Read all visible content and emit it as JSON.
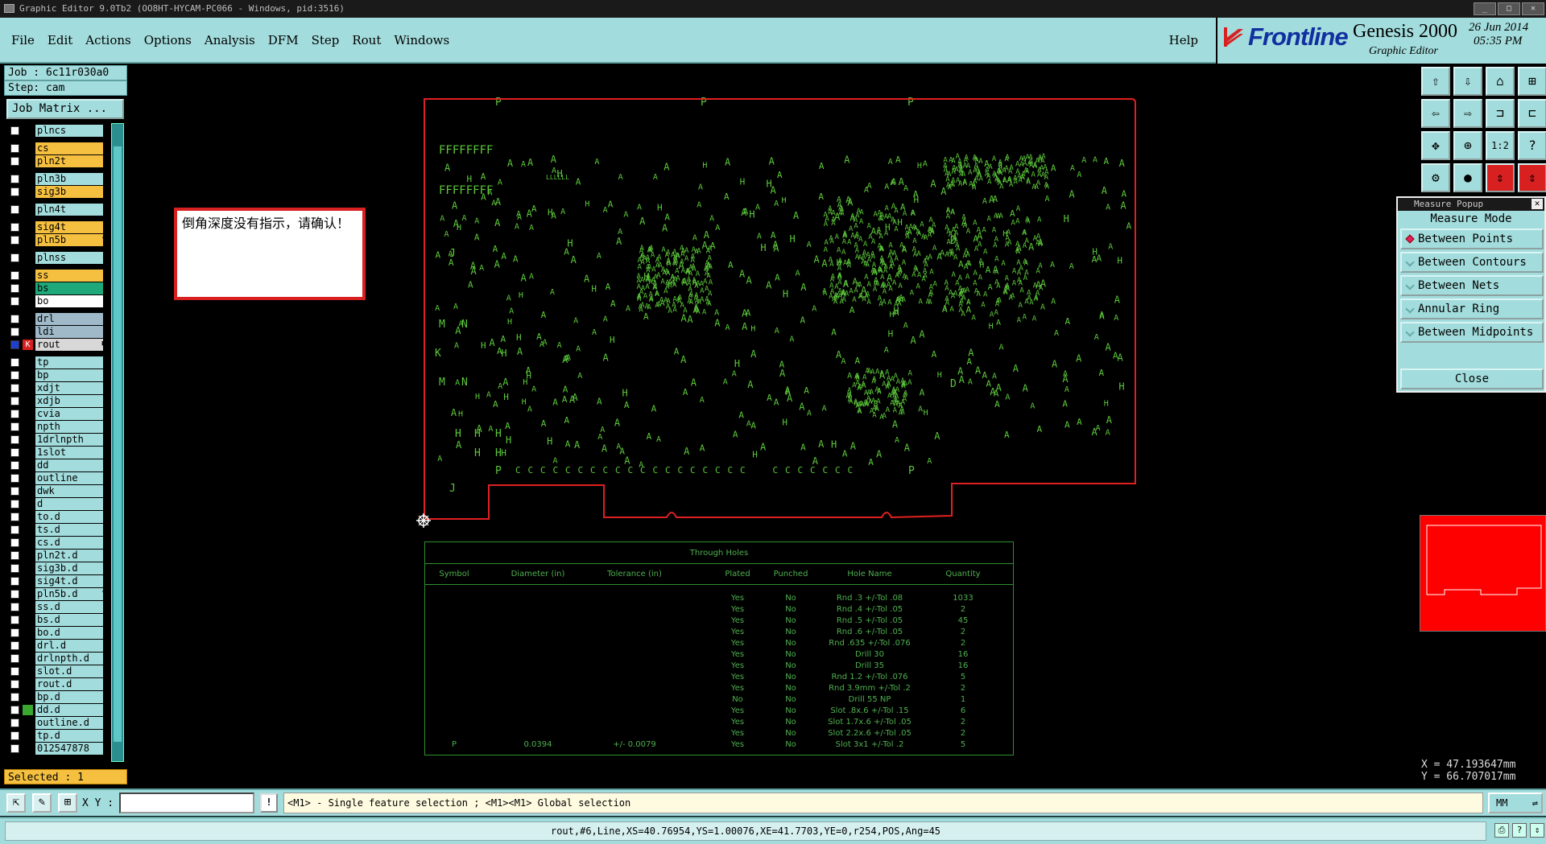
{
  "window": {
    "title": "Graphic Editor 9.0Tb2 (OO8HT-HYCAM-PC066 - Windows, pid:3516)"
  },
  "menu": {
    "items": [
      "File",
      "Edit",
      "Actions",
      "Options",
      "Analysis",
      "DFM",
      "Step",
      "Rout",
      "Windows"
    ],
    "help": "Help"
  },
  "brand": {
    "logo": "Frontline",
    "product": "Genesis 2000",
    "subtitle": "Graphic Editor",
    "date": "26 Jun 2014",
    "time": "05:35 PM"
  },
  "job": {
    "job_label": "Job : 6c11r030a0",
    "step_label": "Step: cam",
    "matrix_button": "Job Matrix ..."
  },
  "layers": [
    {
      "name": "plncs",
      "color": "#a3dcdc"
    },
    {
      "name": "cs",
      "color": "#f5c040"
    },
    {
      "name": "pln2t",
      "color": "#f5c040"
    },
    {
      "name": "pln3b",
      "color": "#a3dcdc"
    },
    {
      "name": "sig3b",
      "color": "#f5c040"
    },
    {
      "name": "pln4t",
      "color": "#a3dcdc"
    },
    {
      "name": "sig4t",
      "color": "#f5c040"
    },
    {
      "name": "pln5b",
      "color": "#f5c040",
      "flag": true
    },
    {
      "name": "plnss",
      "color": "#a3dcdc"
    },
    {
      "name": "ss",
      "color": "#f5c040"
    },
    {
      "name": "bs",
      "color": "#1fa87a"
    },
    {
      "name": "bo",
      "color": "#ffffff"
    },
    {
      "name": "drl",
      "color": "#9fb9c9"
    },
    {
      "name": "ldi",
      "color": "#9fb9c9"
    },
    {
      "name": "rout",
      "color": "#d8d8d8",
      "active": true
    },
    {
      "name": "tp",
      "color": "#a3dcdc"
    },
    {
      "name": "bp",
      "color": "#a3dcdc"
    },
    {
      "name": "xdjt",
      "color": "#a3dcdc"
    },
    {
      "name": "xdjb",
      "color": "#a3dcdc"
    },
    {
      "name": "cvia",
      "color": "#a3dcdc"
    },
    {
      "name": "npth",
      "color": "#a3dcdc"
    },
    {
      "name": "1drlnpth",
      "color": "#a3dcdc"
    },
    {
      "name": "1slot",
      "color": "#a3dcdc"
    },
    {
      "name": "dd",
      "color": "#a3dcdc"
    },
    {
      "name": "outline",
      "color": "#a3dcdc"
    },
    {
      "name": "dwk",
      "color": "#a3dcdc"
    },
    {
      "name": "d",
      "color": "#a3dcdc"
    },
    {
      "name": "to.d",
      "color": "#a3dcdc"
    },
    {
      "name": "ts.d",
      "color": "#a3dcdc"
    },
    {
      "name": "cs.d",
      "color": "#a3dcdc"
    },
    {
      "name": "pln2t.d",
      "color": "#a3dcdc"
    },
    {
      "name": "sig3b.d",
      "color": "#a3dcdc"
    },
    {
      "name": "sig4t.d",
      "color": "#a3dcdc"
    },
    {
      "name": "pln5b.d",
      "color": "#a3dcdc",
      "flag": true
    },
    {
      "name": "ss.d",
      "color": "#a3dcdc"
    },
    {
      "name": "bs.d",
      "color": "#a3dcdc"
    },
    {
      "name": "bo.d",
      "color": "#a3dcdc"
    },
    {
      "name": "drl.d",
      "color": "#a3dcdc"
    },
    {
      "name": "drlnpth.d",
      "color": "#a3dcdc"
    },
    {
      "name": "slot.d",
      "color": "#a3dcdc"
    },
    {
      "name": "rout.d",
      "color": "#a3dcdc"
    },
    {
      "name": "bp.d",
      "color": "#a3dcdc"
    },
    {
      "name": "dd.d",
      "color": "#a3dcdc",
      "green_mark": true
    },
    {
      "name": "outline.d",
      "color": "#a3dcdc"
    },
    {
      "name": "tp.d",
      "color": "#a3dcdc"
    },
    {
      "name": "012547878",
      "color": "#a3dcdc"
    }
  ],
  "selected_label": "Selected : 1",
  "note": {
    "text": "倒角深度没有指示，请确认！"
  },
  "board": {
    "marks": [
      "P",
      "P",
      "P",
      "P",
      "P",
      "J",
      "J",
      "M",
      "M",
      "N",
      "N",
      "K",
      "D",
      "D",
      "G",
      "E",
      "H"
    ],
    "row_labels": [
      "FFFFFFFF",
      "FFFFFFFF",
      "LLLLLL"
    ]
  },
  "hole_table": {
    "title": "Through Holes",
    "headers": [
      "Symbol",
      "Diameter (in)",
      "Tolerance (in)",
      "Plated",
      "Punched",
      "Hole Name",
      "Quantity"
    ],
    "rows": [
      [
        "",
        "",
        "",
        "Yes",
        "No",
        "Rnd .3 +/-Tol .08",
        "1033"
      ],
      [
        "",
        "",
        "",
        "Yes",
        "No",
        "Rnd .4 +/-Tol .05",
        "2"
      ],
      [
        "",
        "",
        "",
        "Yes",
        "No",
        "Rnd .5 +/-Tol .05",
        "45"
      ],
      [
        "",
        "",
        "",
        "Yes",
        "No",
        "Rnd .6 +/-Tol .05",
        "2"
      ],
      [
        "",
        "",
        "",
        "Yes",
        "No",
        "Rnd .635 +/-Tol .076",
        "2"
      ],
      [
        "",
        "",
        "",
        "Yes",
        "No",
        "Drill 30",
        "16"
      ],
      [
        "",
        "",
        "",
        "Yes",
        "No",
        "Drill 35",
        "16"
      ],
      [
        "",
        "",
        "",
        "Yes",
        "No",
        "Rnd 1.2 +/-Tol .076",
        "5"
      ],
      [
        "",
        "",
        "",
        "Yes",
        "No",
        "Rnd 3.9mm +/-Tol .2",
        "2"
      ],
      [
        "",
        "",
        "",
        "No",
        "No",
        "Drill 55 NP",
        "1"
      ],
      [
        "",
        "",
        "",
        "Yes",
        "No",
        "Slot .8x.6 +/-Tol .15",
        "6"
      ],
      [
        "",
        "",
        "",
        "Yes",
        "No",
        "Slot 1.7x.6 +/-Tol .05",
        "2"
      ],
      [
        "",
        "",
        "",
        "Yes",
        "No",
        "Slot 2.2x.6 +/-Tol .05",
        "2"
      ],
      [
        "P",
        "0.0394",
        "+/- 0.0079",
        "Yes",
        "No",
        "Slot 3x1 +/-Tol .2",
        "5"
      ]
    ]
  },
  "toolbar_right": [
    {
      "icon": "home-up-icon",
      "glyph": "⇧"
    },
    {
      "icon": "home-down-icon",
      "glyph": "⇩"
    },
    {
      "icon": "home-icon",
      "glyph": "⌂"
    },
    {
      "icon": "split-window-icon",
      "glyph": "⊞"
    },
    {
      "icon": "pan-left-icon",
      "glyph": "⇦"
    },
    {
      "icon": "pan-right-icon",
      "glyph": "⇨"
    },
    {
      "icon": "route-icon",
      "glyph": "⊐"
    },
    {
      "icon": "snap-icon",
      "glyph": "⊏"
    },
    {
      "icon": "fit-icon",
      "glyph": "✥"
    },
    {
      "icon": "zoom-icon",
      "glyph": "⊕"
    },
    {
      "icon": "scale-label",
      "glyph": "1:2"
    },
    {
      "icon": "help-icon",
      "glyph": "?"
    },
    {
      "icon": "gear-icon",
      "glyph": "⚙"
    },
    {
      "icon": "probe-icon",
      "glyph": "●"
    },
    {
      "icon": "measure-icon",
      "glyph": "⇕"
    },
    {
      "icon": "measure-alt-icon",
      "glyph": "⇕"
    }
  ],
  "measure_popup": {
    "title": "Measure Popup",
    "mode_label": "Measure Mode",
    "options": [
      "Between Points",
      "Between Contours",
      "Between Nets",
      "Annular Ring",
      "Between Midpoints"
    ],
    "selected_index": 0,
    "close_label": "Close"
  },
  "coords": {
    "x": "X = 47.193647mm",
    "y": "Y = 66.707017mm"
  },
  "command_bar": {
    "xy_label": "X Y :",
    "xy_value": "",
    "info_glyph": "!",
    "hint": "<M1> - Single feature selection ; <M1><M1> Global selection",
    "units": "MM"
  },
  "status": {
    "text": "rout,#6,Line,XS=40.76954,YS=1.00076,XE=41.7703,YE=0,r254,POS,Ang=45"
  }
}
